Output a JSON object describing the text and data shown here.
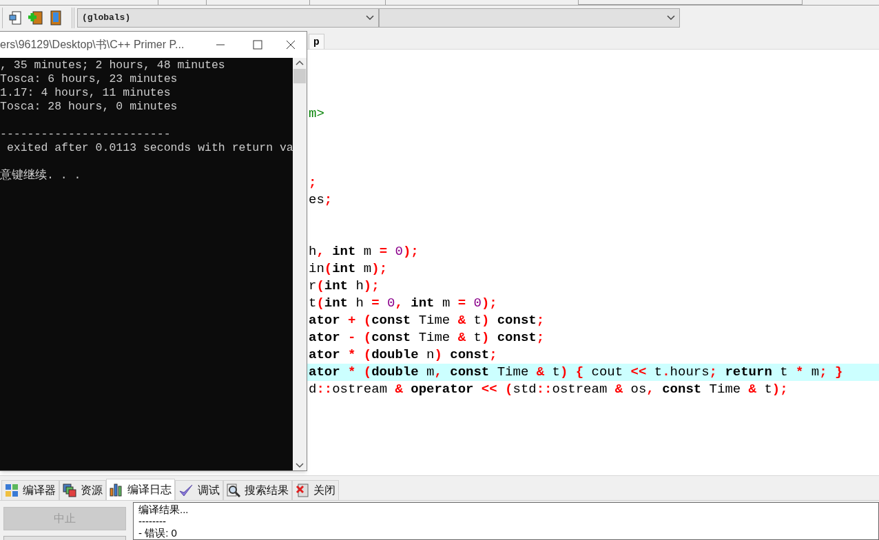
{
  "toolbar": {
    "scope_dropdown": {
      "value": "(globals)"
    }
  },
  "editor": {
    "tab_label": "p",
    "lines": [
      {
        "kind": "blank",
        "highlighted": false
      },
      {
        "kind": "blank",
        "highlighted": false
      },
      {
        "kind": "blank",
        "highlighted": false
      },
      {
        "kind": "code",
        "highlighted": false,
        "tokens": [
          {
            "text": "m>",
            "kind": "pre"
          }
        ]
      },
      {
        "kind": "blank",
        "highlighted": false
      },
      {
        "kind": "blank",
        "highlighted": false
      },
      {
        "kind": "blank",
        "highlighted": false
      },
      {
        "kind": "code",
        "highlighted": false,
        "tokens": [
          {
            "text": ";",
            "kind": "op"
          }
        ]
      },
      {
        "kind": "code",
        "highlighted": false,
        "tokens": [
          {
            "text": "es",
            "kind": "plain"
          },
          {
            "text": ";",
            "kind": "op"
          }
        ]
      },
      {
        "kind": "blank",
        "highlighted": false
      },
      {
        "kind": "blank",
        "highlighted": false
      },
      {
        "kind": "code",
        "highlighted": false,
        "tokens": [
          {
            "text": "h",
            "kind": "plain"
          },
          {
            "text": ", ",
            "kind": "op"
          },
          {
            "text": "int",
            "kind": "kw"
          },
          {
            "text": " m ",
            "kind": "plain"
          },
          {
            "text": "= ",
            "kind": "op"
          },
          {
            "text": "0",
            "kind": "num"
          },
          {
            "text": ");",
            "kind": "op"
          }
        ]
      },
      {
        "kind": "code",
        "highlighted": false,
        "tokens": [
          {
            "text": "in",
            "kind": "plain"
          },
          {
            "text": "(",
            "kind": "op"
          },
          {
            "text": "int",
            "kind": "kw"
          },
          {
            "text": " m",
            "kind": "plain"
          },
          {
            "text": ");",
            "kind": "op"
          }
        ]
      },
      {
        "kind": "code",
        "highlighted": false,
        "tokens": [
          {
            "text": "r",
            "kind": "plain"
          },
          {
            "text": "(",
            "kind": "op"
          },
          {
            "text": "int",
            "kind": "kw"
          },
          {
            "text": " h",
            "kind": "plain"
          },
          {
            "text": ");",
            "kind": "op"
          }
        ]
      },
      {
        "kind": "code",
        "highlighted": false,
        "tokens": [
          {
            "text": "t",
            "kind": "plain"
          },
          {
            "text": "(",
            "kind": "op"
          },
          {
            "text": "int",
            "kind": "kw"
          },
          {
            "text": " h ",
            "kind": "plain"
          },
          {
            "text": "= ",
            "kind": "op"
          },
          {
            "text": "0",
            "kind": "num"
          },
          {
            "text": ", ",
            "kind": "op"
          },
          {
            "text": "int",
            "kind": "kw"
          },
          {
            "text": " m ",
            "kind": "plain"
          },
          {
            "text": "= ",
            "kind": "op"
          },
          {
            "text": "0",
            "kind": "num"
          },
          {
            "text": ");",
            "kind": "op"
          }
        ]
      },
      {
        "kind": "code",
        "highlighted": false,
        "tokens": [
          {
            "text": "ator",
            "kind": "kw"
          },
          {
            "text": " + (",
            "kind": "op"
          },
          {
            "text": "const",
            "kind": "kw"
          },
          {
            "text": " Time ",
            "kind": "plain"
          },
          {
            "text": "&",
            "kind": "op"
          },
          {
            "text": " t",
            "kind": "plain"
          },
          {
            "text": ") ",
            "kind": "op"
          },
          {
            "text": "const",
            "kind": "kw"
          },
          {
            "text": ";",
            "kind": "op"
          }
        ]
      },
      {
        "kind": "code",
        "highlighted": false,
        "tokens": [
          {
            "text": "ator",
            "kind": "kw"
          },
          {
            "text": " - (",
            "kind": "op"
          },
          {
            "text": "const",
            "kind": "kw"
          },
          {
            "text": " Time ",
            "kind": "plain"
          },
          {
            "text": "&",
            "kind": "op"
          },
          {
            "text": " t",
            "kind": "plain"
          },
          {
            "text": ") ",
            "kind": "op"
          },
          {
            "text": "const",
            "kind": "kw"
          },
          {
            "text": ";",
            "kind": "op"
          }
        ]
      },
      {
        "kind": "code",
        "highlighted": false,
        "tokens": [
          {
            "text": "ator",
            "kind": "kw"
          },
          {
            "text": " * (",
            "kind": "op"
          },
          {
            "text": "double",
            "kind": "kw"
          },
          {
            "text": " n",
            "kind": "plain"
          },
          {
            "text": ") ",
            "kind": "op"
          },
          {
            "text": "const",
            "kind": "kw"
          },
          {
            "text": ";",
            "kind": "op"
          }
        ]
      },
      {
        "kind": "code",
        "highlighted": true,
        "tokens": [
          {
            "text": "ator",
            "kind": "kw"
          },
          {
            "text": " * (",
            "kind": "op"
          },
          {
            "text": "double",
            "kind": "kw"
          },
          {
            "text": " m",
            "kind": "plain"
          },
          {
            "text": ", ",
            "kind": "op"
          },
          {
            "text": "const",
            "kind": "kw"
          },
          {
            "text": " Time ",
            "kind": "plain"
          },
          {
            "text": "&",
            "kind": "op"
          },
          {
            "text": " t",
            "kind": "plain"
          },
          {
            "text": ") { ",
            "kind": "op"
          },
          {
            "text": "cout ",
            "kind": "plain"
          },
          {
            "text": "<<",
            "kind": "op"
          },
          {
            "text": " t",
            "kind": "plain"
          },
          {
            "text": ".",
            "kind": "op"
          },
          {
            "text": "hours",
            "kind": "plain"
          },
          {
            "text": "; ",
            "kind": "op"
          },
          {
            "text": "return",
            "kind": "kw"
          },
          {
            "text": " t ",
            "kind": "plain"
          },
          {
            "text": "*",
            "kind": "op"
          },
          {
            "text": " m",
            "kind": "plain"
          },
          {
            "text": "; }",
            "kind": "op"
          }
        ]
      },
      {
        "kind": "code",
        "highlighted": false,
        "tokens": [
          {
            "text": "d",
            "kind": "plain"
          },
          {
            "text": "::",
            "kind": "op"
          },
          {
            "text": "ostream ",
            "kind": "plain"
          },
          {
            "text": "& ",
            "kind": "op"
          },
          {
            "text": "operator",
            "kind": "kw"
          },
          {
            "text": " << (",
            "kind": "op"
          },
          {
            "text": "std",
            "kind": "plain"
          },
          {
            "text": "::",
            "kind": "op"
          },
          {
            "text": "ostream ",
            "kind": "plain"
          },
          {
            "text": "&",
            "kind": "op"
          },
          {
            "text": " os",
            "kind": "plain"
          },
          {
            "text": ", ",
            "kind": "op"
          },
          {
            "text": "const",
            "kind": "kw"
          },
          {
            "text": " Time ",
            "kind": "plain"
          },
          {
            "text": "&",
            "kind": "op"
          },
          {
            "text": " t",
            "kind": "plain"
          },
          {
            "text": ");",
            "kind": "op"
          }
        ]
      }
    ]
  },
  "console": {
    "title": "ers\\96129\\Desktop\\书\\C++ Primer P...",
    "lines": [
      {
        "kind": "text",
        "text": ", 35 minutes; 2 hours, 48 minutes"
      },
      {
        "kind": "text",
        "text": "Tosca: 6 hours, 23 minutes"
      },
      {
        "kind": "text",
        "text": "1.17: 4 hours, 11 minutes"
      },
      {
        "kind": "text",
        "text": "Tosca: 28 hours, 0 minutes"
      },
      {
        "kind": "blank"
      },
      {
        "kind": "text",
        "text": "-------------------------"
      },
      {
        "kind": "text",
        "text": " exited after 0.0113 seconds with return va"
      },
      {
        "kind": "blank"
      },
      {
        "kind": "text",
        "text": "意键继续. . ."
      }
    ]
  },
  "bottom_panel": {
    "tabs": [
      {
        "label": "编译器",
        "selected": false
      },
      {
        "label": "资源",
        "selected": false
      },
      {
        "label": "编译日志",
        "selected": true
      },
      {
        "label": "调试",
        "selected": false
      },
      {
        "label": "搜索结果",
        "selected": false
      },
      {
        "label": "关闭",
        "selected": false
      }
    ],
    "abort_button": {
      "label": "中止",
      "disabled": true
    },
    "log_lines": [
      "编译结果...",
      "--------",
      "- 错误: 0"
    ]
  }
}
